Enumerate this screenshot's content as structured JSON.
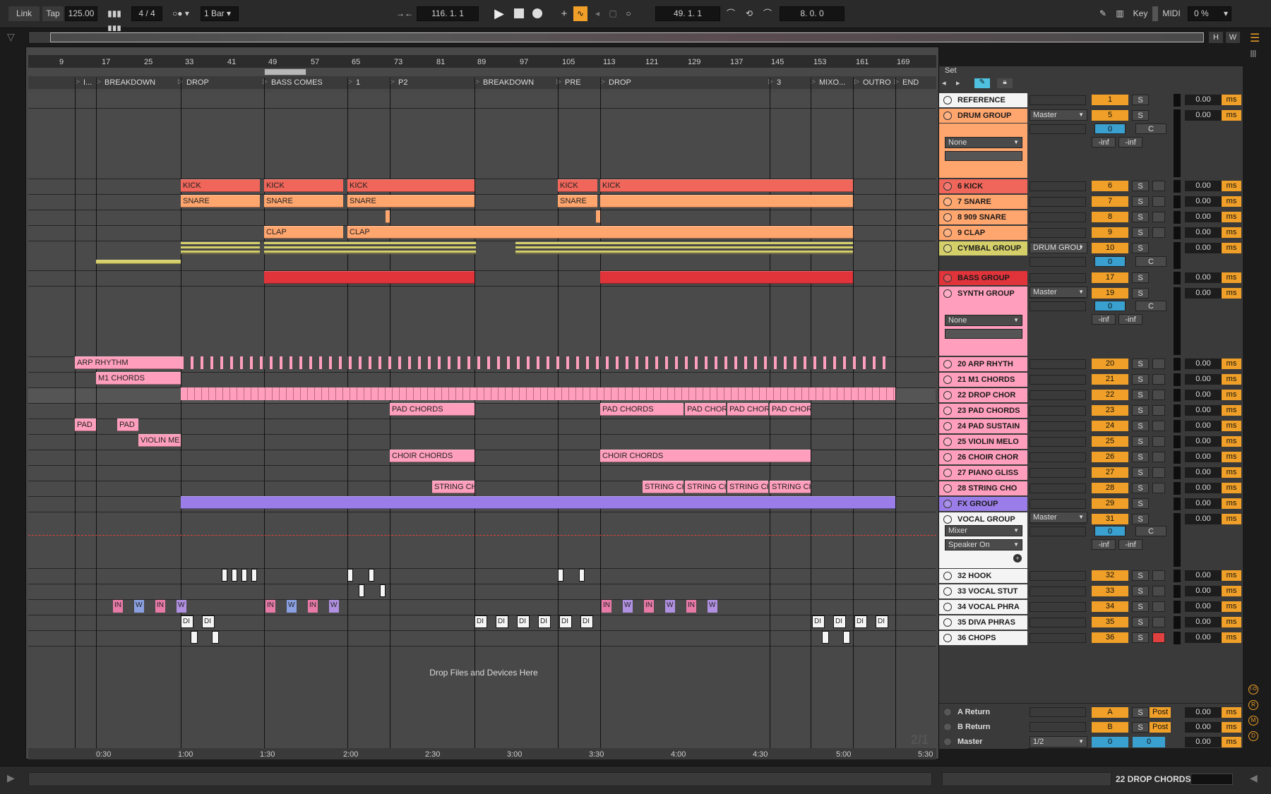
{
  "toolbar": {
    "link": "Link",
    "tap": "Tap",
    "tempo": "125.00",
    "signature": "4 / 4",
    "quantize": "1 Bar",
    "position": "116.  1.  1",
    "loop_start": "49.  1.  1",
    "loop_length": "8.  0.  0",
    "key": "Key",
    "midi": "MIDI",
    "cpu": "0 %"
  },
  "ruler": {
    "bars": [
      "9",
      "17",
      "25",
      "33",
      "41",
      "49",
      "57",
      "65",
      "73",
      "81",
      "89",
      "97",
      "105",
      "113",
      "121",
      "129",
      "137",
      "145",
      "153",
      "161",
      "169"
    ],
    "times": [
      "0:30",
      "1:00",
      "1:30",
      "2:00",
      "2:30",
      "3:00",
      "3:30",
      "4:00",
      "4:30",
      "5:00",
      "5:30"
    ]
  },
  "locators": [
    {
      "label": "I..."
    },
    {
      "label": "BREAKDOWN"
    },
    {
      "label": "DROP"
    },
    {
      "label": "BASS COMES"
    },
    {
      "label": "1"
    },
    {
      "label": "P2"
    },
    {
      "label": "BREAKDOWN"
    },
    {
      "label": "PRE"
    },
    {
      "label": "DROP"
    },
    {
      "label": "3"
    },
    {
      "label": "MIXO..."
    },
    {
      "label": "OUTRO"
    },
    {
      "label": "END"
    }
  ],
  "clips": {
    "kick": "KICK",
    "snare": "SNARE",
    "clap": "CLAP",
    "arp": "ARP RHYTHM",
    "m1": "M1 CHORDS",
    "pad": "PAD",
    "pad_chords": "PAD CHORDS",
    "pad_chor": "PAD CHOR",
    "violin": "VIOLIN ME",
    "choir": "CHOIR CHORDS",
    "string": "STRING CH",
    "drop_files": "Drop Files and Devices Here",
    "in": "IN",
    "w": "W",
    "di": "DI"
  },
  "mixer": {
    "set": "Set",
    "master_out": "Master",
    "none": "None",
    "inf": "-inf",
    "c": "C",
    "zero": "0",
    "s": "S",
    "vol": "0.00",
    "ms": "ms",
    "post": "Post",
    "drum_grou": "DRUM GROU",
    "mixer_dd": "Mixer",
    "speaker": "Speaker On",
    "half": "1/2"
  },
  "tracks": [
    {
      "name": "REFERENCE",
      "num": "1",
      "color": "#f4f4f4"
    },
    {
      "name": "DRUM GROUP",
      "num": "5",
      "color": "#ffa56e"
    },
    {
      "name": "6 KICK",
      "num": "6",
      "color": "#f0665a"
    },
    {
      "name": "7 SNARE",
      "num": "7",
      "color": "#ffa56e"
    },
    {
      "name": "8 909 SNARE",
      "num": "8",
      "color": "#ffa56e"
    },
    {
      "name": "9 CLAP",
      "num": "9",
      "color": "#ffa56e"
    },
    {
      "name": "CYMBAL GROUP",
      "num": "10",
      "color": "#d5cf6a"
    },
    {
      "name": "BASS GROUP",
      "num": "17",
      "color": "#e0343a"
    },
    {
      "name": "SYNTH GROUP",
      "num": "19",
      "color": "#ff9fbd"
    },
    {
      "name": "20 ARP RHYTH",
      "num": "20",
      "color": "#ff9fbd"
    },
    {
      "name": "21 M1 CHORDS",
      "num": "21",
      "color": "#ff9fbd"
    },
    {
      "name": "22 DROP CHOR",
      "num": "22",
      "color": "#ff9fbd"
    },
    {
      "name": "23 PAD CHORDS",
      "num": "23",
      "color": "#ff9fbd"
    },
    {
      "name": "24 PAD SUSTAIN",
      "num": "24",
      "color": "#ff9fbd"
    },
    {
      "name": "25 VIOLIN MELO",
      "num": "25",
      "color": "#ff9fbd"
    },
    {
      "name": "26 CHOIR CHOR",
      "num": "26",
      "color": "#ff9fbd"
    },
    {
      "name": "27 PIANO GLISS",
      "num": "27",
      "color": "#ff9fbd"
    },
    {
      "name": "28 STRING CHO",
      "num": "28",
      "color": "#ff9fbd"
    },
    {
      "name": "FX GROUP",
      "num": "29",
      "color": "#9a7de8"
    },
    {
      "name": "VOCAL GROUP",
      "num": "31",
      "color": "#f4f4f4"
    },
    {
      "name": "32 HOOK",
      "num": "32",
      "color": "#f4f4f4"
    },
    {
      "name": "33 VOCAL STUT",
      "num": "33",
      "color": "#f4f4f4"
    },
    {
      "name": "34 VOCAL PHRA",
      "num": "34",
      "color": "#f4f4f4"
    },
    {
      "name": "35 DIVA PHRAS",
      "num": "35",
      "color": "#f4f4f4"
    },
    {
      "name": "36 CHOPS",
      "num": "36",
      "color": "#f4f4f4"
    }
  ],
  "returns": [
    {
      "name": "A Return",
      "num": "A"
    },
    {
      "name": "B Return",
      "num": "B"
    },
    {
      "name": "Master",
      "num": "0"
    }
  ],
  "status": {
    "selected": "22 DROP CHORDS",
    "page": "2/1"
  }
}
